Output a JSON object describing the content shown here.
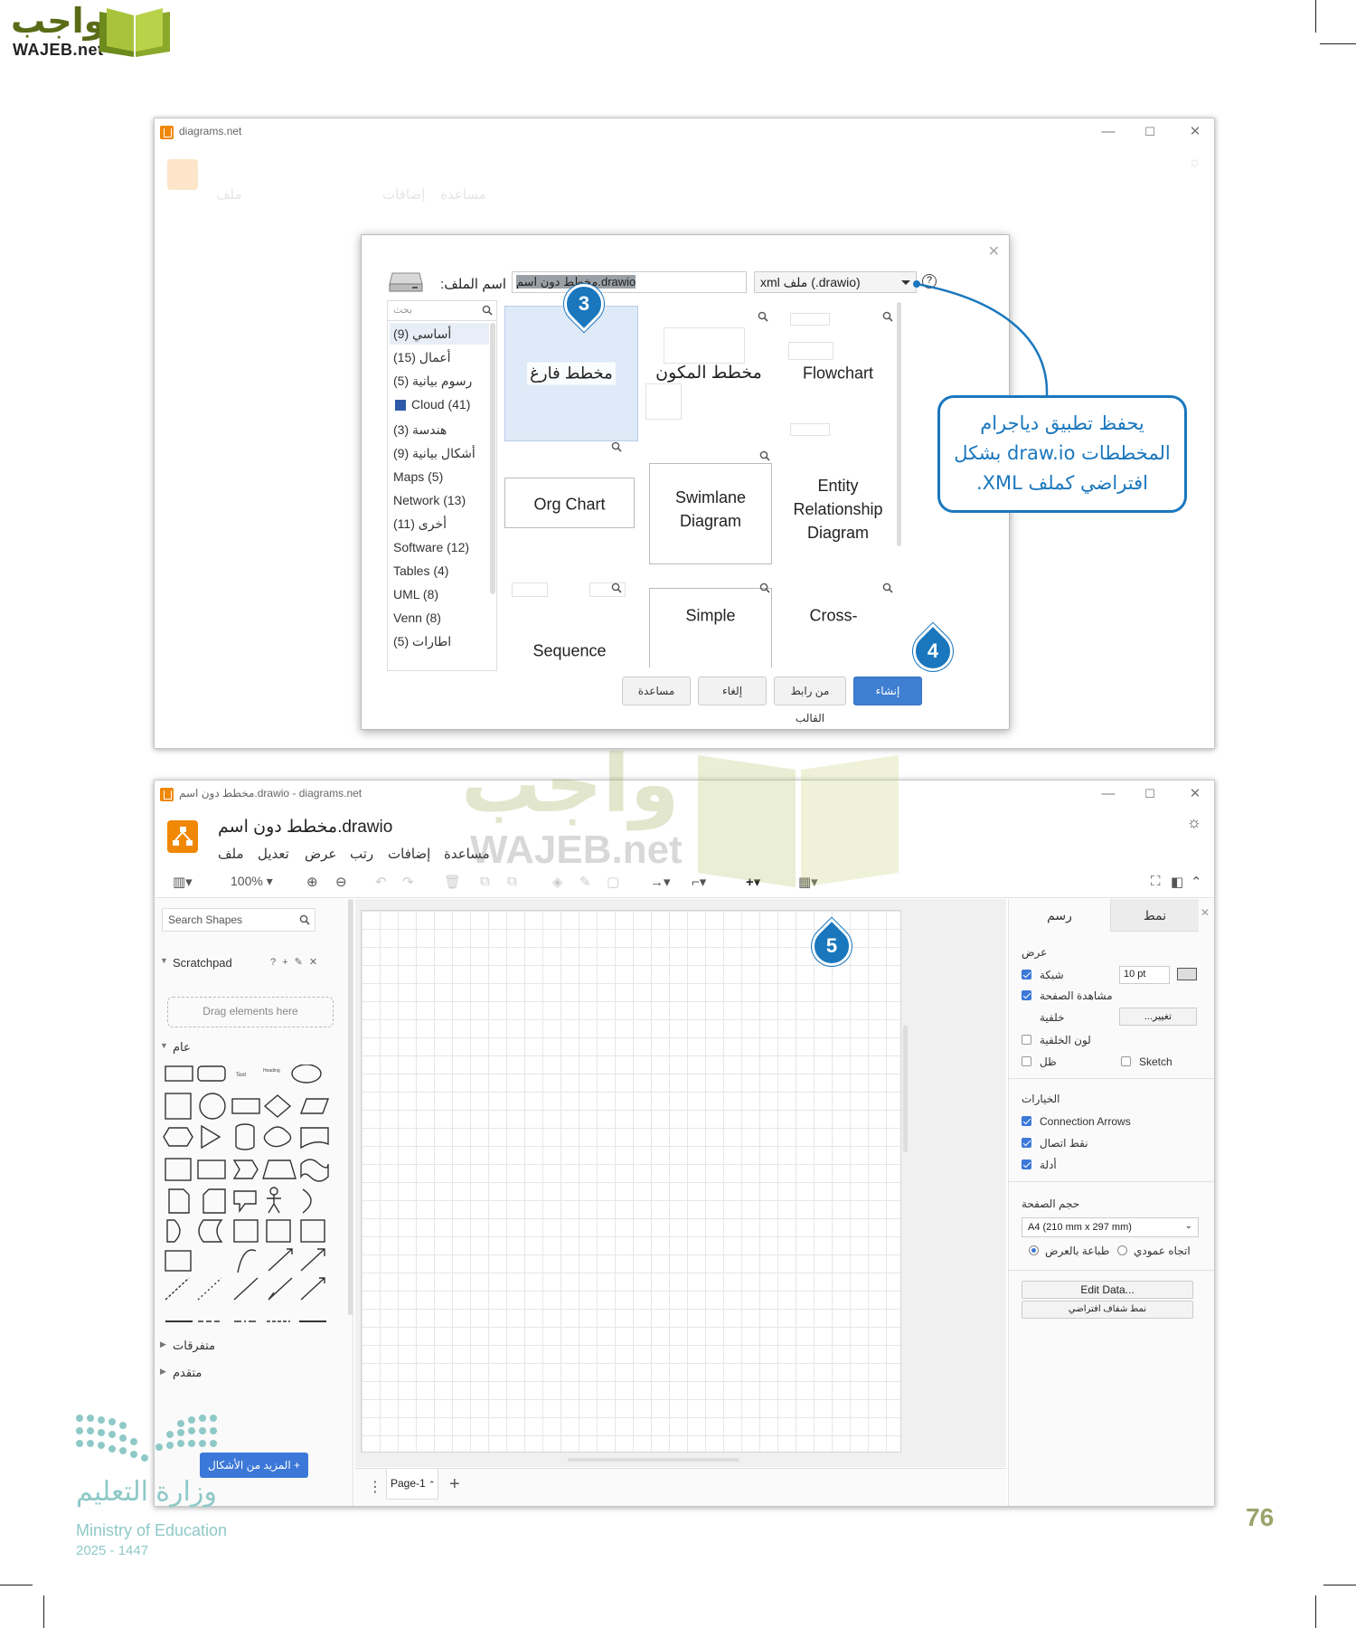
{
  "brand": {
    "logo_ar": "واجب",
    "logo_en": "WAJEB.net"
  },
  "page_number": "76",
  "ministry": {
    "name_ar": "وزارة التعليم",
    "name_en": "Ministry of Education",
    "year": "2025 - 1447"
  },
  "dialog_window": {
    "title": "diagrams.net",
    "faded_menu": [
      "ملف",
      "إضافات",
      "مساعدة"
    ],
    "filename_label": "اسم الملف:",
    "filename_value": "مخطط دون اسم.drawio",
    "filetype_value": "xml ملف (.drawio)",
    "help": "?",
    "category_search_placeholder": "بحث",
    "categories": [
      "أساسي (9)",
      "أعمال (15)",
      "رسوم بيانية (5)",
      "Cloud (41)",
      "هندسة (3)",
      "أشكال بيانية (9)",
      "Maps (5)",
      "Network (13)",
      "أخرى (11)",
      "Software (12)",
      "Tables (4)",
      "UML (8)",
      "Venn (8)",
      "اطارات (5)"
    ],
    "templates": [
      "مخطط فارغ",
      "مخطط المكون",
      "Flowchart",
      "Org Chart",
      "Swimlane Diagram",
      "Entity Relationship Diagram",
      "Sequence",
      "Simple",
      "Cross-"
    ],
    "buttons": {
      "create": "إنشاء",
      "from_template_url": "من رابط القالب",
      "cancel": "إلغاء",
      "help": "مساعدة"
    }
  },
  "callouts": {
    "step3": "3",
    "step4": "4",
    "step5": "5",
    "note": "يحفظ تطبيق دياجرام المخططات draw.io بشكل افتراضي كملف XML."
  },
  "editor_window": {
    "title": "مخطط دون اسم.drawio - diagrams.net",
    "doc_title": "مخطط دون اسم.drawio",
    "menu": [
      "ملف",
      "تعديل",
      "عرض",
      "رتب",
      "إضافات",
      "مساعدة"
    ],
    "zoom": "100%",
    "search_shapes_placeholder": "Search Shapes",
    "scratchpad": "Scratchpad",
    "scratchpad_tools": "? + ✎ ✕",
    "drag_here": "Drag elements here",
    "general": "عام",
    "misc": "متفرقات",
    "advanced": "متقدم",
    "more_shapes": "+ المزيد من الأشكال",
    "page_tab": "Page-1",
    "right_tabs": [
      "رسم",
      "نمط"
    ],
    "view_section": "عرض",
    "grid": "شبكة",
    "grid_size": "10 pt",
    "page_view": "مشاهدة الصفحة",
    "background": "خلفية",
    "change": "تغيير...",
    "background_color": "لون الخلفية",
    "shadow": "ظل",
    "sketch": "Sketch",
    "options_section": "الخيارات",
    "connection_arrows": "Connection Arrows",
    "connection_points": "نقط اتصال",
    "guides": "أدلة",
    "page_size_section": "حجم الصفحة",
    "page_size_value": "A4 (210 mm x 297 mm)",
    "landscape": "طباعة بالعرض",
    "portrait": "اتجاه عمودي",
    "edit_data": "Edit Data...",
    "default_style": "نمط شفاف افتراضي"
  },
  "colors": {
    "accent_blue": "#1a77bd",
    "drawio_orange": "#f08705",
    "button_blue": "#3f7fd2"
  }
}
